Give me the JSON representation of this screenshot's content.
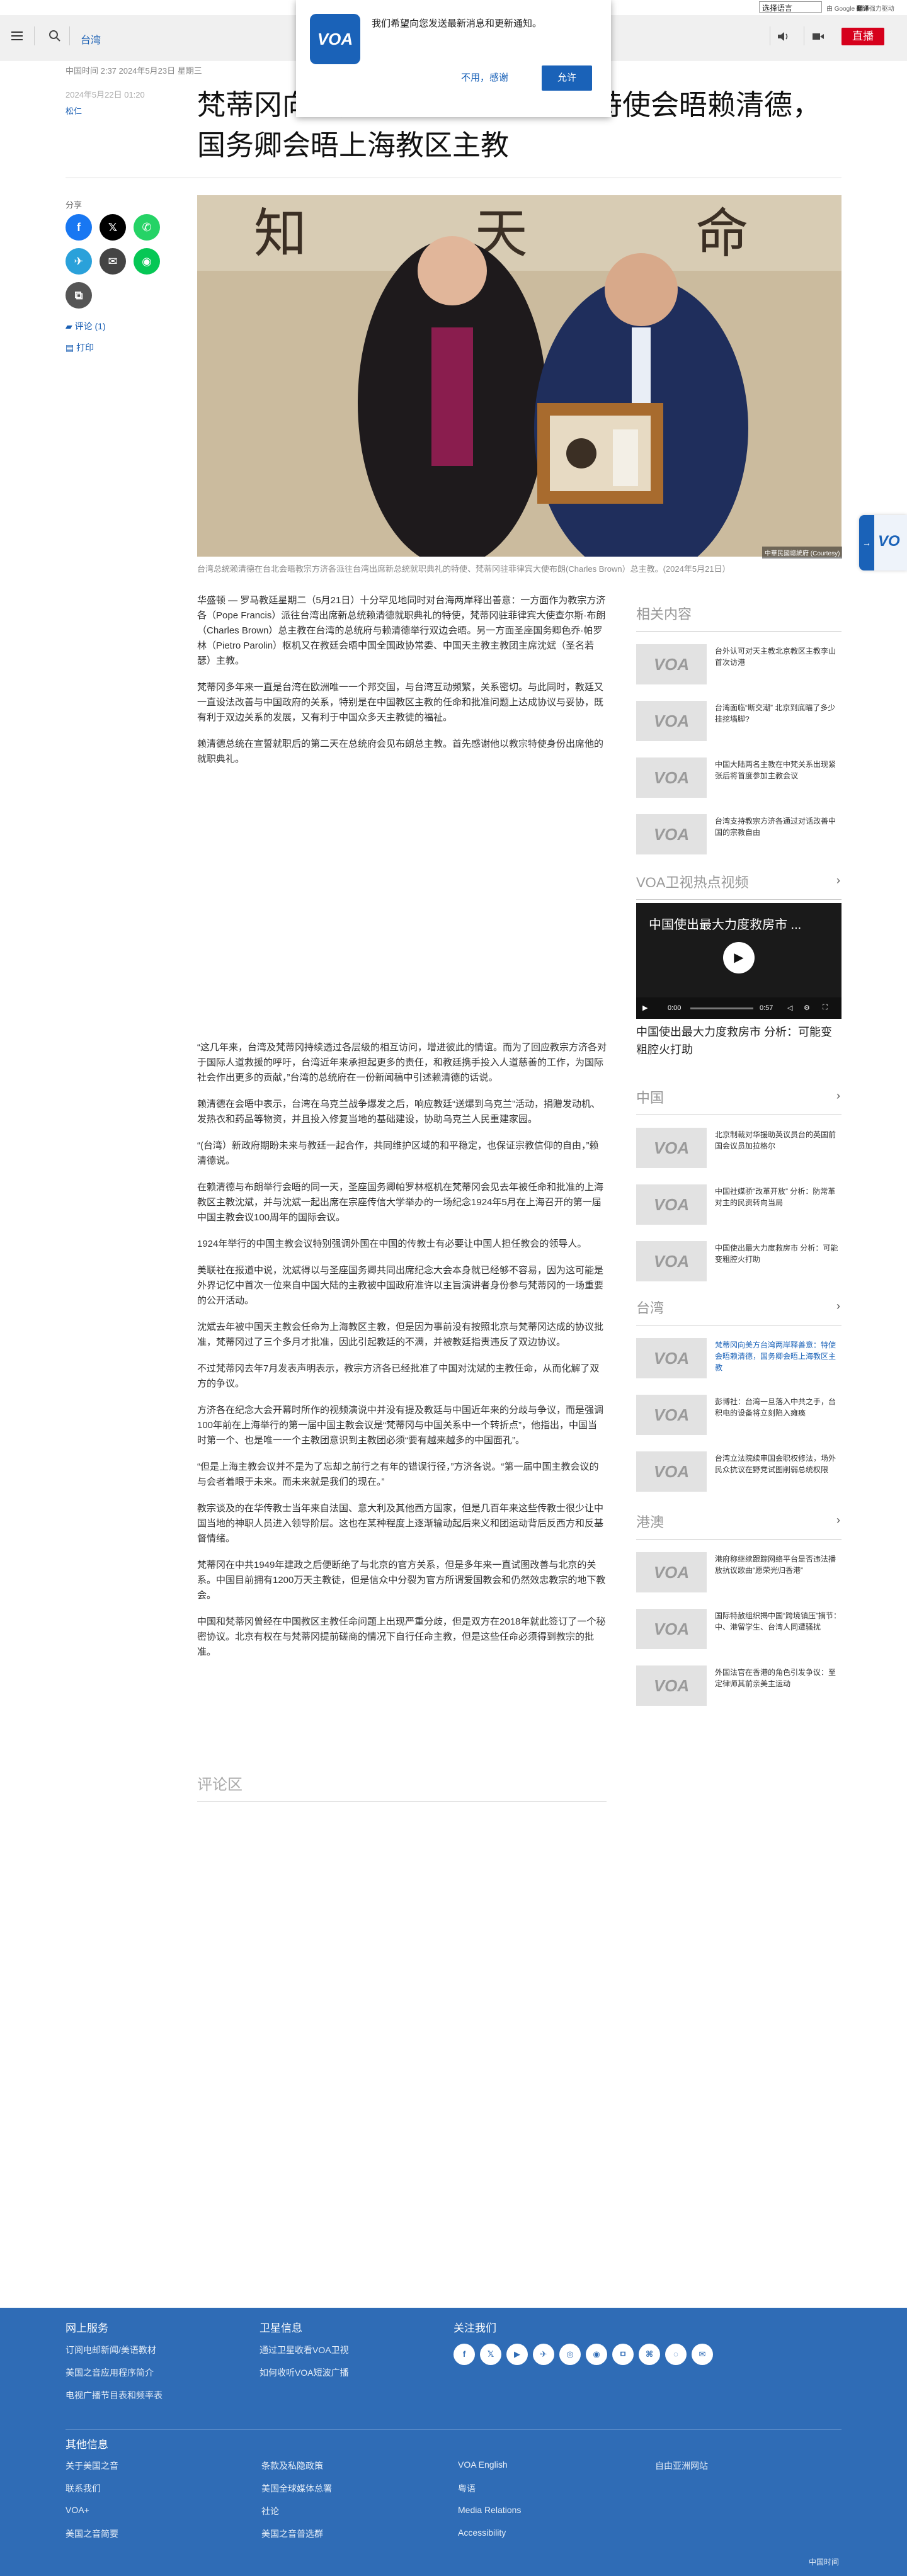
{
  "topbar": {
    "language_select": "选择语言",
    "powered_by": "由 Google",
    "translate": "翻译",
    "translate_suffix": "强力驱动"
  },
  "navbar": {
    "section": "台湾",
    "live_label": "直播"
  },
  "popup": {
    "logo": "VOA",
    "message": "我们希望向您发送最新消息和更新通知。",
    "decline": "不用，感谢",
    "accept": "允许"
  },
  "article": {
    "china_time": "中国时间 2:37 2024年5月23日 星期三",
    "date": "2024年5月22日 01:20",
    "byline": "松仁",
    "headline": "梵蒂冈向美方台湾两岸释善意：特使会晤赖清德，国务卿会晤上海教区主教",
    "share_label": "分享",
    "comments_link": "评论 (1)",
    "print_link": "打印",
    "photo_credit": "中華民國總統府 (Courtesy)",
    "photo_text": "知 天 命 道 寬",
    "caption": "台湾总统赖清德在台北会晤教宗方济各派往台湾出席新总统就职典礼的特使、梵蒂冈驻菲律宾大使布朗(Charles Brown）总主教。(2024年5月21日）",
    "paras_top": [
      "华盛顿 — 罗马教廷星期二（5月21日）十分罕见地同时对台海两岸释出善意：一方面作为教宗方济各（Pope Francis）派往台湾出席新总统赖清德就职典礼的特使，梵蒂冈驻菲律宾大使查尔斯·布朗（Charles Brown）总主教在台湾的总统府与赖清德举行双边会晤。另一方面圣座国务卿色乔·帕罗林（Pietro Parolin）枢机又在教廷会晤中国全国政协常委、中国天主教主教团主席沈斌（圣名若瑟）主教。",
      "梵蒂冈多年来一直是台湾在欧洲唯一一个邦交国，与台湾互动频繁，关系密切。与此同时，教廷又一直设法改善与中国政府的关系，特别是在中国教区主教的任命和批准问题上达成协议与妥协，既有利于双边关系的发展，又有利于中国众多天主教徒的福祉。",
      "赖清德总统在宣誓就职后的第二天在总统府会见布朗总主教。首先感谢他以教宗特使身份出席他的就职典礼。"
    ],
    "paras_bottom": [
      "“这几年来，台湾及梵蒂冈持续透过各层级的相互访问，增进彼此的情谊。而为了回应教宗方济各对于国际人道救援的呼吁，台湾近年来承担起更多的责任，和教廷携手投入人道慈善的工作，为国际社会作出更多的贡献，”台湾的总统府在一份新闻稿中引述赖清德的话说。",
      "赖清德在会晤中表示，台湾在乌克兰战争爆发之后，响应教廷“送爆到乌克兰”活动，捐赠发动机、发热衣和药品等物资，并且投入修复当地的基础建设，协助乌克兰人民重建家园。",
      "“(台湾）新政府期盼未来与教廷一起合作，共同维护区域的和平稳定，也保证宗教信仰的自由，”赖清德说。",
      "在赖清德与布朗举行会晤的同一天，圣座国务卿帕罗林枢机在梵蒂冈会见去年被任命和批准的上海教区主教沈斌，并与沈斌一起出席在宗座传信大学举办的一场纪念1924年5月在上海召开的第一届中国主教会议100周年的国际会议。",
      "1924年举行的中国主教会议特别强调外国在中国的传教士有必要让中国人担任教会的领导人。",
      "美联社在报道中说，沈斌得以与圣座国务卿共同出席纪念大会本身就已经够不容易，因为这可能是外界记忆中首次一位来自中国大陆的主教被中国政府准许以主旨演讲者身份参与梵蒂冈的一场重要的公开活动。",
      "沈斌去年被中国天主教会任命为上海教区主教，但是因为事前没有按照北京与梵蒂冈达成的协议批准，梵蒂冈过了三个多月才批准，因此引起教廷的不满，并被教廷指责违反了双边协议。",
      "不过梵蒂冈去年7月发表声明表示，教宗方济各已经批准了中国对沈斌的主教任命，从而化解了双方的争议。",
      "方济各在纪念大会开幕时所作的视频演说中并没有提及教廷与中国近年来的分歧与争议，而是强调100年前在上海举行的第一届中国主教会议是“梵蒂冈与中国关系中一个转折点”，他指出，中国当时第一个、也是唯一一个主教团意识到主教团必须“要有越来越多的中国面孔”。",
      "“但是上海主教会议并不是为了忘却之前行之有年的错误行径，”方济各说。“第一届中国主教会议的与会者着眼于未来。而未来就是我们的现在。”",
      "教宗谈及的在华传教士当年来自法国、意大利及其他西方国家，但是几百年来这些传教士很少让中国当地的神职人员进入领导阶层。这也在某种程度上逐渐输动起后来义和团运动背后反西方和反基督情绪。",
      "梵蒂冈在中共1949年建政之后便断绝了与北京的官方关系，但是多年来一直试图改善与北京的关系。中国目前拥有1200万天主教徒，但是信众中分裂为官方所谓爱国教会和仍然效忠教宗的地下教会。",
      "中国和梵蒂冈曾经在中国教区主教任命问题上出现严重分歧，但是双方在2018年就此签订了一个秘密协议。北京有权在与梵蒂冈提前磋商的情况下自行任命主教，但是这些任命必须得到教宗的批准。"
    ],
    "comments_heading": "评论区"
  },
  "rail": {
    "related": {
      "heading": "相关内容",
      "items": [
        "台外认可对天主教北京教区主教李山首次访港",
        "台湾面临“断交潮” 北京到底瞄了多少挂挖墙脚?",
        "中国大陆两名主教在中梵关系出现紧张后将首度参加主教会议",
        "台湾支持教宗方济各通过对话改善中国的宗教自由"
      ]
    },
    "video": {
      "heading": "VOA卫视热点视频",
      "title": "中国使出最大力度救房市 ...",
      "time_now": "0:00",
      "time_total": "0:57",
      "caption": "中国使出最大力度救房市 分析：可能变粗腔火打助"
    },
    "china": {
      "heading": "中国",
      "items": [
        "北京制裁对华援助英议员台的英国前国会议员加拉格尔",
        "中国社媒骄“改革开放” 分析：防常革对主的民资转向当局",
        "中国使出最大力度救房市 分析：可能变粗腔火打助"
      ]
    },
    "taiwan": {
      "heading": "台湾",
      "items": [
        "梵蒂冈向美方台湾两岸释善意：特使会晤赖清德，国务卿会晤上海教区主教",
        "彭博社：台湾一旦落入中共之手，台积电的设备将立刻陷入瘫痪",
        "台湾立法院续审国会职权修法，场外民众抗议在野党试图削弱总统权限"
      ]
    },
    "hongkong": {
      "heading": "港澳",
      "items": [
        "港府称继续跟踪网络平台是否违法播放抗议歌曲“愿荣光归香港”",
        "国际特赦组织揭中国“跨境镇压”摘节：中、港留学生、台湾人同遭骚扰",
        "外国法官在香港的角色引发争议：至定律师其前亲美主运动"
      ]
    }
  },
  "footer": {
    "col1_heading": "网上服务",
    "col1_links": [
      "订阅电邮新闻/美语教材",
      "美国之音应用程序简介",
      "电视广播节目表和频率表"
    ],
    "col2_heading": "卫星信息",
    "col2_links": [
      "通过卫星收看VOA卫视",
      "如何收听VOA短波广播"
    ],
    "col3_heading": "关注我们",
    "social": [
      "f",
      "𝕏",
      "▶",
      "✈",
      "◎",
      "◉",
      "ㅁ",
      "⌘",
      "◌",
      "✉"
    ],
    "other_heading": "其他信息",
    "other_links": [
      [
        "关于美国之音",
        "条款及私隐政策",
        "VOA English",
        "自由亚洲网站"
      ],
      [
        "联系我们",
        "美国全球媒体总署",
        "粤语",
        ""
      ],
      [
        "VOA+",
        "社论",
        "Media Relations",
        ""
      ],
      [
        "美国之音简要",
        "美国之音普选群",
        "Accessibility",
        ""
      ]
    ],
    "time": "中国时间"
  },
  "colors": {
    "brand_blue": "#1a62b8",
    "live_red": "#d6001c",
    "footer_blue": "#2f6cb6"
  }
}
